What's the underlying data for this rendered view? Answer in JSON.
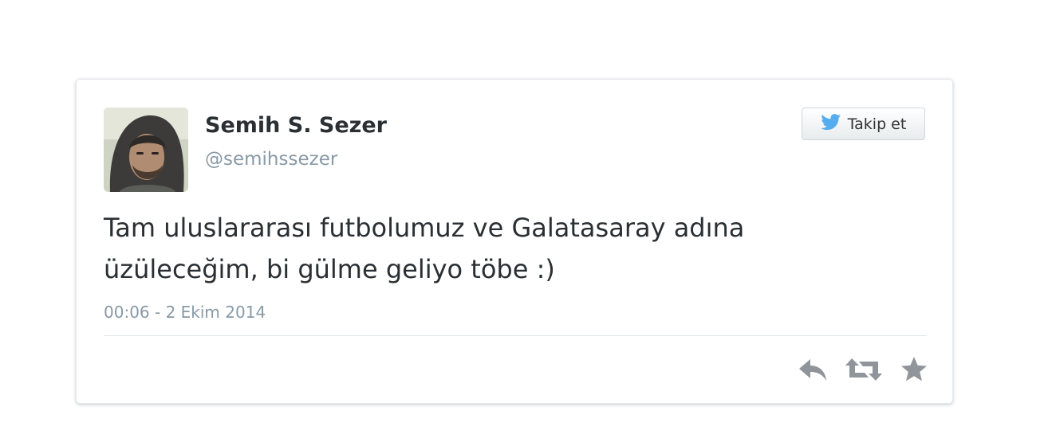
{
  "tweet": {
    "display_name": "Semih S. Sezer",
    "screen_name": "@semihssezer",
    "text_line1": "Tam uluslararası futbolumuz ve Galatasaray adına",
    "text_line2": "üzüleceğim, bi gülme geliyo töbe :)",
    "timestamp": "00:06 - 2 Ekim 2014"
  },
  "follow_button": {
    "label": "Takip et",
    "icon": "twitter-bird-icon"
  },
  "actions": [
    {
      "icon": "reply-icon"
    },
    {
      "icon": "retweet-icon"
    },
    {
      "icon": "favorite-star-icon"
    }
  ],
  "colors": {
    "text": "#292f33",
    "muted": "#8899a6",
    "brand": "#55acee",
    "action_icon": "#8f959a"
  }
}
